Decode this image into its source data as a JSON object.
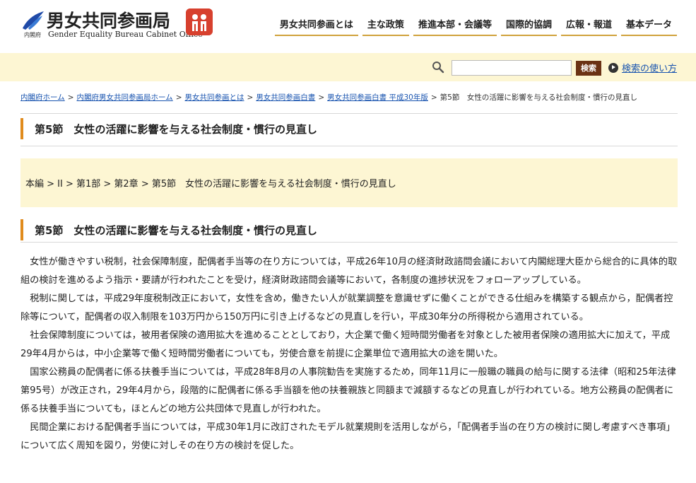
{
  "header": {
    "logo_small": "内閣府",
    "logo_title": "男女共同参画局",
    "logo_en": "Gender Equality Bureau Cabinet Office",
    "nav": [
      "男女共同参画とは",
      "主な政策",
      "推進本部・会議等",
      "国際的協調",
      "広報・報道",
      "基本データ"
    ]
  },
  "search": {
    "placeholder": "",
    "button_label": "検索",
    "howto_label": "検索の使い方"
  },
  "breadcrumb": {
    "items": [
      "内閣府ホーム",
      "内閣府男女共同参画局ホーム",
      "男女共同参画とは",
      "男女共同参画白書",
      "男女共同参画白書 平成30年版"
    ],
    "separator": ">",
    "current": "第5節　女性の活躍に影響を与える社会制度・慣行の見直し"
  },
  "page": {
    "heading1": "第5節　女性の活躍に影響を与える社会制度・慣行の見直し",
    "path_text": "本編 > II > 第1部 > 第2章 > 第5節　女性の活躍に影響を与える社会制度・慣行の見直し",
    "heading2": "第5節　女性の活躍に影響を与える社会制度・慣行の見直し",
    "paragraphs": [
      "女性が働きやすい税制，社会保障制度，配偶者手当等の在り方については，平成26年10月の経済財政諮問会議において内閣総理大臣から総合的に具体的取組の検討を進めるよう指示・要請が行われたことを受け，経済財政諮問会議等において，各制度の進捗状況をフォローアップしている。",
      "税制に関しては，平成29年度税制改正において，女性を含め，働きたい人が就業調整を意識せずに働くことができる仕組みを構築する観点から，配偶者控除等について，配偶者の収入制限を103万円から150万円に引き上げるなどの見直しを行い，平成30年分の所得税から適用されている。",
      "社会保障制度については，被用者保険の適用拡大を進めることとしており，大企業で働く短時間労働者を対象とした被用者保険の適用拡大に加えて，平成29年4月からは，中小企業等で働く短時間労働者についても，労使合意を前提に企業単位で適用拡大の途を開いた。",
      "国家公務員の配偶者に係る扶養手当については，平成28年8月の人事院勧告を実施するため，同年11月に一般職の職員の給与に関する法律（昭和25年法律第95号）が改正され，29年4月から，段階的に配偶者に係る手当額を他の扶養親族と同額まで減額するなどの見直しが行われている。地方公務員の配偶者に係る扶養手当についても，ほとんどの地方公共団体で見直しが行われた。",
      "民間企業における配偶者手当については，平成30年1月に改訂されたモデル就業規則を活用しながら，「配偶者手当の在り方の検討に関し考慮すべき事項」について広く周知を図り，労使に対しその在り方の検討を促した。"
    ]
  },
  "colors": {
    "accent": "#e08b1d",
    "nav_underline": "#d0a23c",
    "band": "#fdf6d3",
    "search_button": "#6b3214",
    "link": "#1a55b0",
    "logo_emblem": "#d7402e"
  },
  "icons": [
    "gender-equality-logo-icon",
    "logo-emblem-icon",
    "search-icon",
    "arrow-circle-icon"
  ]
}
